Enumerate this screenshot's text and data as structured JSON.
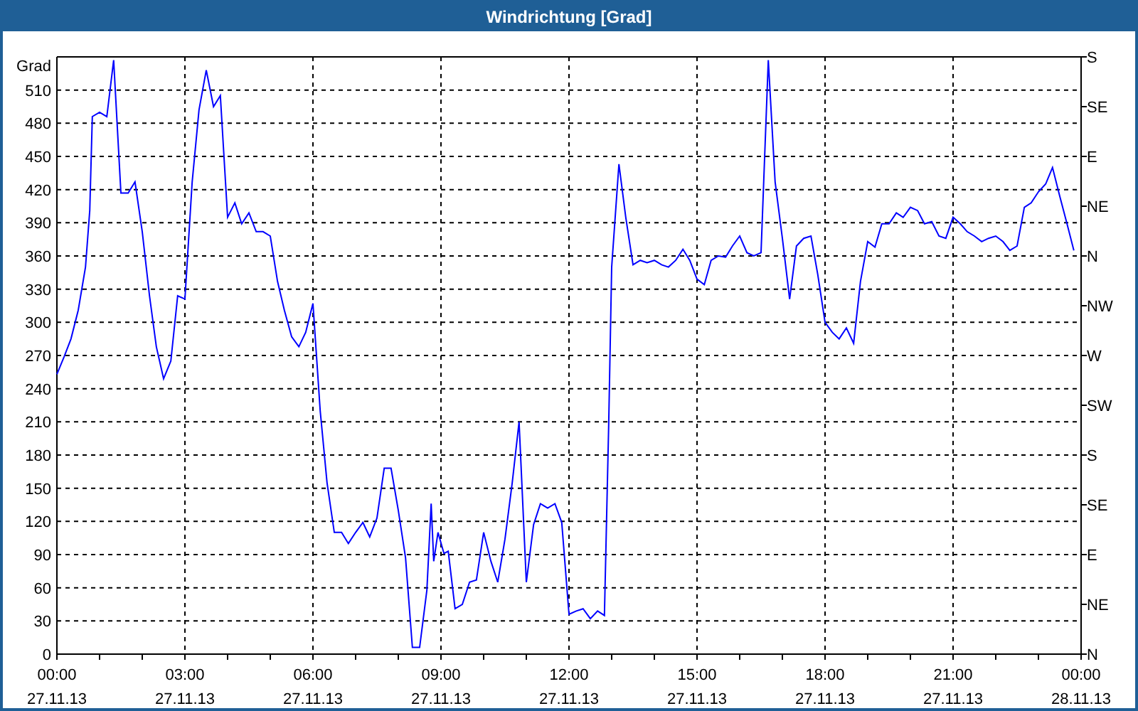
{
  "window": {
    "title": "Windrichtung [Grad]"
  },
  "chart": {
    "chart_data": {
      "type": "line",
      "ylabel": "Grad",
      "xlim": [
        0,
        24
      ],
      "ylim": [
        0,
        540
      ],
      "x": [
        0,
        0.17,
        0.33,
        0.5,
        0.67,
        0.77,
        0.83,
        1,
        1.17,
        1.33,
        1.5,
        1.67,
        1.83,
        2,
        2.17,
        2.33,
        2.5,
        2.67,
        2.83,
        3,
        3.17,
        3.33,
        3.5,
        3.67,
        3.83,
        4,
        4.17,
        4.33,
        4.5,
        4.67,
        4.83,
        5,
        5.17,
        5.33,
        5.5,
        5.67,
        5.83,
        6,
        6.17,
        6.33,
        6.5,
        6.67,
        6.83,
        7,
        7.17,
        7.33,
        7.5,
        7.67,
        7.83,
        8,
        8.17,
        8.33,
        8.5,
        8.67,
        8.77,
        8.83,
        8.93,
        9.07,
        9.17,
        9.33,
        9.5,
        9.67,
        9.83,
        10,
        10.17,
        10.33,
        10.5,
        10.67,
        10.83,
        11,
        11.17,
        11.33,
        11.5,
        11.67,
        11.83,
        12,
        12.17,
        12.33,
        12.5,
        12.67,
        12.83,
        12.93,
        13,
        13.17,
        13.33,
        13.5,
        13.67,
        13.83,
        14,
        14.17,
        14.33,
        14.5,
        14.67,
        14.83,
        15,
        15.17,
        15.33,
        15.5,
        15.67,
        15.83,
        16,
        16.17,
        16.33,
        16.5,
        16.67,
        16.83,
        17,
        17.17,
        17.33,
        17.5,
        17.67,
        17.83,
        18,
        18.17,
        18.33,
        18.5,
        18.67,
        18.83,
        19,
        19.17,
        19.33,
        19.5,
        19.67,
        19.83,
        20,
        20.17,
        20.33,
        20.5,
        20.67,
        20.83,
        21,
        21.17,
        21.33,
        21.5,
        21.67,
        21.83,
        22,
        22.17,
        22.33,
        22.5,
        22.67,
        22.83,
        23,
        23.17,
        23.33,
        23.5,
        23.67,
        23.83
      ],
      "grid": true,
      "series": [
        {
          "color": "#0000ff",
          "values": [
            253,
            269,
            285,
            311,
            350,
            401,
            486,
            490,
            486,
            537,
            417,
            417,
            427,
            382,
            324,
            278,
            249,
            265,
            324,
            321,
            427,
            492,
            528,
            495,
            505,
            395,
            408,
            389,
            399,
            382,
            382,
            378,
            337,
            311,
            287,
            278,
            291,
            317,
            220,
            155,
            110,
            110,
            100,
            110,
            119,
            106,
            123,
            168,
            168,
            130,
            87,
            6,
            6,
            58,
            136,
            84,
            110,
            91,
            93,
            41,
            45,
            65,
            67,
            110,
            84,
            65,
            104,
            155,
            210,
            65,
            117,
            136,
            132,
            136,
            119,
            36,
            39,
            41,
            32,
            39,
            35,
            207,
            350,
            443,
            395,
            352,
            356,
            354,
            356,
            352,
            350,
            356,
            366,
            356,
            339,
            334,
            356,
            360,
            359,
            369,
            378,
            363,
            360,
            363,
            537,
            427,
            376,
            321,
            369,
            376,
            378,
            343,
            300,
            291,
            285,
            295,
            281,
            337,
            373,
            368,
            389,
            389,
            399,
            395,
            404,
            401,
            389,
            391,
            378,
            376,
            395,
            389,
            382,
            378,
            373,
            376,
            378,
            373,
            365,
            369,
            404,
            408,
            418,
            425,
            440,
            414,
            389,
            365
          ]
        }
      ],
      "xticks": [
        {
          "value": 0,
          "label": "00:00"
        },
        {
          "value": 3,
          "label": "03:00"
        },
        {
          "value": 6,
          "label": "06:00"
        },
        {
          "value": 9,
          "label": "09:00"
        },
        {
          "value": 12,
          "label": "12:00"
        },
        {
          "value": 15,
          "label": "15:00"
        },
        {
          "value": 18,
          "label": "18:00"
        },
        {
          "value": 21,
          "label": "21:00"
        },
        {
          "value": 24,
          "label": "00:00"
        }
      ],
      "yticks": [
        0,
        30,
        60,
        90,
        120,
        150,
        180,
        210,
        240,
        270,
        300,
        330,
        360,
        390,
        420,
        450,
        480,
        510
      ]
    },
    "x_dates": [
      "27.11.13",
      "27.11.13",
      "27.11.13",
      "27.11.13",
      "27.11.13",
      "27.11.13",
      "27.11.13",
      "27.11.13",
      "28.11.13"
    ],
    "right_axis": {
      "labels": [
        "S",
        "SE",
        "E",
        "NE",
        "N",
        "NW",
        "W",
        "SW",
        "S",
        "SE",
        "E",
        "NE",
        "N"
      ]
    }
  }
}
